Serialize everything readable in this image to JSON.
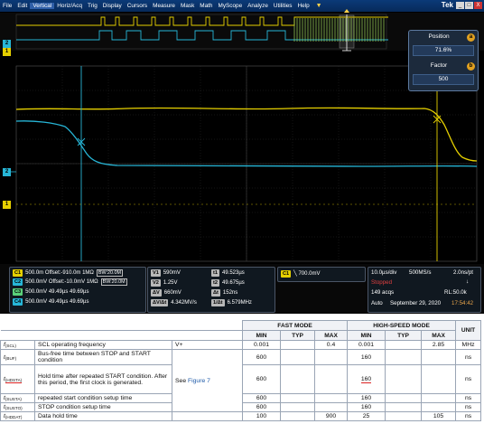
{
  "menubar": {
    "items": [
      "File",
      "Edit",
      "Vertical",
      "Horiz/Acq",
      "Trig",
      "Display",
      "Cursors",
      "Measure",
      "Mask",
      "Math",
      "MyScope",
      "Analyze",
      "Utilities",
      "Help"
    ],
    "brand": "Tek",
    "window_buttons": [
      "_",
      "□",
      "X"
    ]
  },
  "position_box": {
    "position_label": "Position",
    "position_value": "71.6%",
    "factor_label": "Factor",
    "factor_value": "500",
    "knob_a": "a",
    "knob_b": "b"
  },
  "markers": {
    "ch1": "1",
    "ch2": "2"
  },
  "channels": [
    {
      "tag": "C1",
      "scale": "500.0m",
      "offset": "Offset:-910.0m",
      "imp": "1MΩ",
      "bw": "BW:20.0M"
    },
    {
      "tag": "C2",
      "scale": "500.0mV",
      "offset": "Offset:-10.0mV",
      "imp": "1MΩ",
      "bw": "BW:20.0M"
    },
    {
      "tag": "C3",
      "scale": "500.0mV",
      "val1": "49.49µs",
      "val2": "49.69µs"
    },
    {
      "tag": "C4",
      "scale": "500.0mV",
      "val1": "49.49µs",
      "val2": "49.69µs"
    }
  ],
  "cursors": {
    "v1": {
      "tag": "V1",
      "value": "590mV"
    },
    "v2": {
      "tag": "V2",
      "value": "1.25V"
    },
    "dv": {
      "tag": "ΔV",
      "value": "660mV"
    },
    "dvdt": {
      "tag": "ΔV/Δt",
      "value": "4.342MV/s"
    },
    "t1": {
      "tag": "t1",
      "value": "49.523µs"
    },
    "t2": {
      "tag": "t2",
      "value": "49.675µs"
    },
    "dt": {
      "tag": "Δt",
      "value": "152ns"
    },
    "inv": {
      "tag": "1/Δt",
      "value": "6.579MHz"
    }
  },
  "trigger": {
    "tag": "C1",
    "slope": "╲",
    "level": "700.0mV"
  },
  "acquisition": {
    "timebase": "10.0µs/div",
    "samplerate": "500MS/s",
    "ptres": "2.0ns/pt",
    "state": "Stopped",
    "acqs": "149 acqs",
    "rl": "RL:50.0k",
    "mode": "Auto",
    "date": "September 29, 2020",
    "time": "17:54:42"
  },
  "table": {
    "group_headers": [
      "FAST MODE",
      "HIGH-SPEED MODE",
      "UNIT"
    ],
    "sub_headers": [
      "MIN",
      "TYP",
      "MAX",
      "MIN",
      "TYP",
      "MAX"
    ],
    "note_prefix": "See",
    "note_link": "Figure 7",
    "rows": [
      {
        "sym": "f",
        "sub": "(SCL)",
        "desc": "SCL operating frequency",
        "cond": "V+",
        "fmin": "0.001",
        "ftyp": "",
        "fmax": "0.4",
        "hmin": "0.001",
        "htyp": "",
        "hmax": "2.85",
        "unit": "MHz"
      },
      {
        "sym": "t",
        "sub": "(BUF)",
        "desc": "Bus-free time between STOP and START condition",
        "cond": "",
        "fmin": "600",
        "ftyp": "",
        "fmax": "",
        "hmin": "160",
        "htyp": "",
        "hmax": "",
        "unit": "ns"
      },
      {
        "sym": "t",
        "sub": "(HDSTA)",
        "desc": "Hold time after repeated START condition. After this period, the first clock is generated.",
        "cond": "",
        "fmin": "600",
        "ftyp": "",
        "fmax": "",
        "hmin": "160",
        "htyp": "",
        "hmax": "",
        "unit": "ns"
      },
      {
        "sym": "t",
        "sub": "(SUSTA)",
        "desc": "repeated start condition setup time",
        "cond": "",
        "fmin": "600",
        "ftyp": "",
        "fmax": "",
        "hmin": "160",
        "htyp": "",
        "hmax": "",
        "unit": "ns"
      },
      {
        "sym": "t",
        "sub": "(SUSTO)",
        "desc": "STOP condition setup time",
        "cond": "",
        "fmin": "600",
        "ftyp": "",
        "fmax": "",
        "hmin": "160",
        "htyp": "",
        "hmax": "",
        "unit": "ns"
      },
      {
        "sym": "t",
        "sub": "(HDDAT)",
        "desc": "Data hold time",
        "cond": "",
        "fmin": "100",
        "ftyp": "",
        "fmax": "900",
        "hmin": "25",
        "htyp": "",
        "hmax": "105",
        "unit": "ns"
      }
    ]
  },
  "colors": {
    "ch1": "#e6d000",
    "ch2": "#27b6d7",
    "accent": "#e04040"
  }
}
